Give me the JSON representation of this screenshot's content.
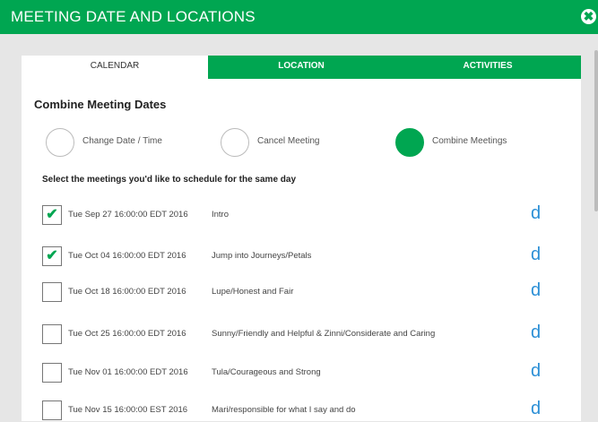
{
  "modal": {
    "title": "MEETING DATE AND LOCATIONS",
    "close_glyph": "✖"
  },
  "tabs": [
    {
      "label": "CALENDAR",
      "active": true
    },
    {
      "label": "LOCATION",
      "active": false
    },
    {
      "label": "ACTIVITIES",
      "active": false
    }
  ],
  "section_title": "Combine Meeting Dates",
  "options": [
    {
      "label": "Change Date / Time",
      "selected": false
    },
    {
      "label": "Cancel Meeting",
      "selected": false
    },
    {
      "label": "Combine Meetings",
      "selected": true
    }
  ],
  "instructions": "Select the meetings you'd like to schedule for the same day",
  "meetings": [
    {
      "date": "Tue Sep 27 16:00:00 EDT 2016",
      "title": "Intro",
      "checked": true,
      "check_glyph": "✔",
      "action": "d"
    },
    {
      "date": "Tue Oct 04 16:00:00 EDT 2016",
      "title": "Jump into Journeys/Petals",
      "checked": true,
      "check_glyph": "✔",
      "action": "d"
    },
    {
      "date": "Tue Oct 18 16:00:00 EDT 2016",
      "title": "Lupe/Honest and Fair",
      "checked": false,
      "check_glyph": "",
      "action": "d"
    },
    {
      "date": "Tue Oct 25 16:00:00 EDT 2016",
      "title": "Sunny/Friendly and Helpful & Zinni/Considerate and Caring",
      "checked": false,
      "check_glyph": "",
      "action": "d"
    },
    {
      "date": "Tue Nov 01 16:00:00 EDT 2016",
      "title": "Tula/Courageous and Strong",
      "checked": false,
      "check_glyph": "",
      "action": "d"
    },
    {
      "date": "Tue Nov 15 16:00:00 EST 2016",
      "title": "Mari/responsible for what I say and do",
      "checked": false,
      "check_glyph": "",
      "action": "d"
    }
  ],
  "colors": {
    "accent": "#00a651",
    "action": "#2b8fd6"
  }
}
